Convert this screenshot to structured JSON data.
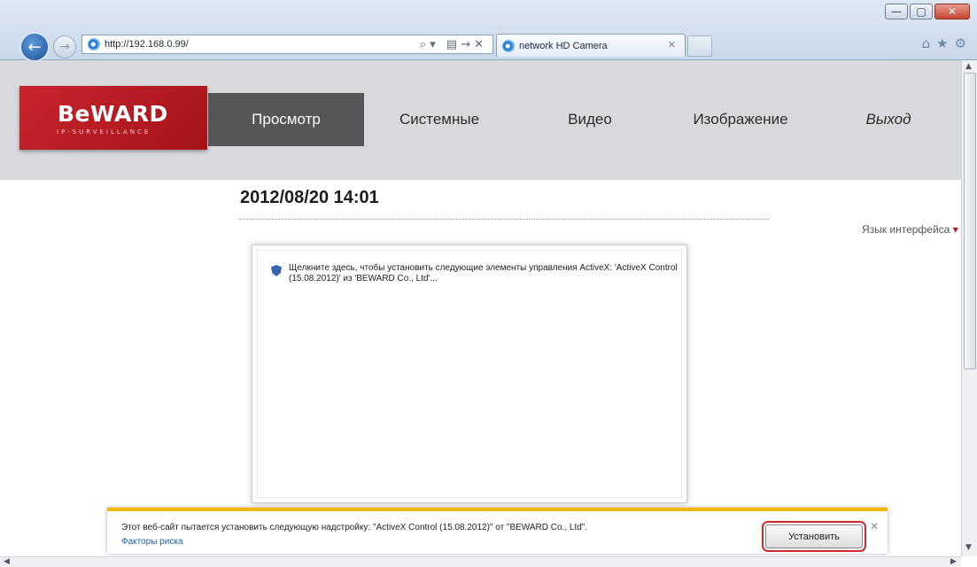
{
  "browser": {
    "address_url": "http://192.168.0.99/",
    "address_tools": "⌕▾ ▤→✕",
    "tab_title": "network HD Camera",
    "tab_close": "✕",
    "back_icon": "←",
    "forward_icon": "→",
    "window_controls": {
      "minimize": "—",
      "maximize": "▢",
      "close": "✕"
    },
    "toolbar_icons": {
      "home": "⌂",
      "favorites": "★",
      "settings": "⚙"
    }
  },
  "logo": {
    "text": "BeWARD",
    "subtext": "IP-SURVEILLANCE"
  },
  "menu": {
    "items": [
      {
        "label": "Просмотр"
      },
      {
        "label": "Системные"
      },
      {
        "label": "Видео"
      },
      {
        "label": "Изображение"
      },
      {
        "label": "Выход"
      }
    ]
  },
  "content": {
    "datetime": "2012/08/20 14:01",
    "language_label": "Язык интерфейса",
    "language_arrow": "▾",
    "activex_message": "Щелкните здесь, чтобы установить следующие элементы управления ActiveX: 'ActiveX Control (15.08.2012)' из 'BEWARD Co., Ltd'..."
  },
  "notification": {
    "text": "Этот веб-сайт пытается установить следующую надстройку: \"ActiveX Control (15.08.2012)\" от \"BEWARD Co., Ltd\".",
    "link": "Факторы риска",
    "install_label": "Установить",
    "close": "✕"
  },
  "scrollbar": {
    "up": "▲",
    "down": "▼",
    "left": "◀",
    "right": "▶"
  },
  "colors": {
    "brand_red": "#c8252c",
    "menu_active": "#565656",
    "notification_accent": "#f4b400"
  }
}
